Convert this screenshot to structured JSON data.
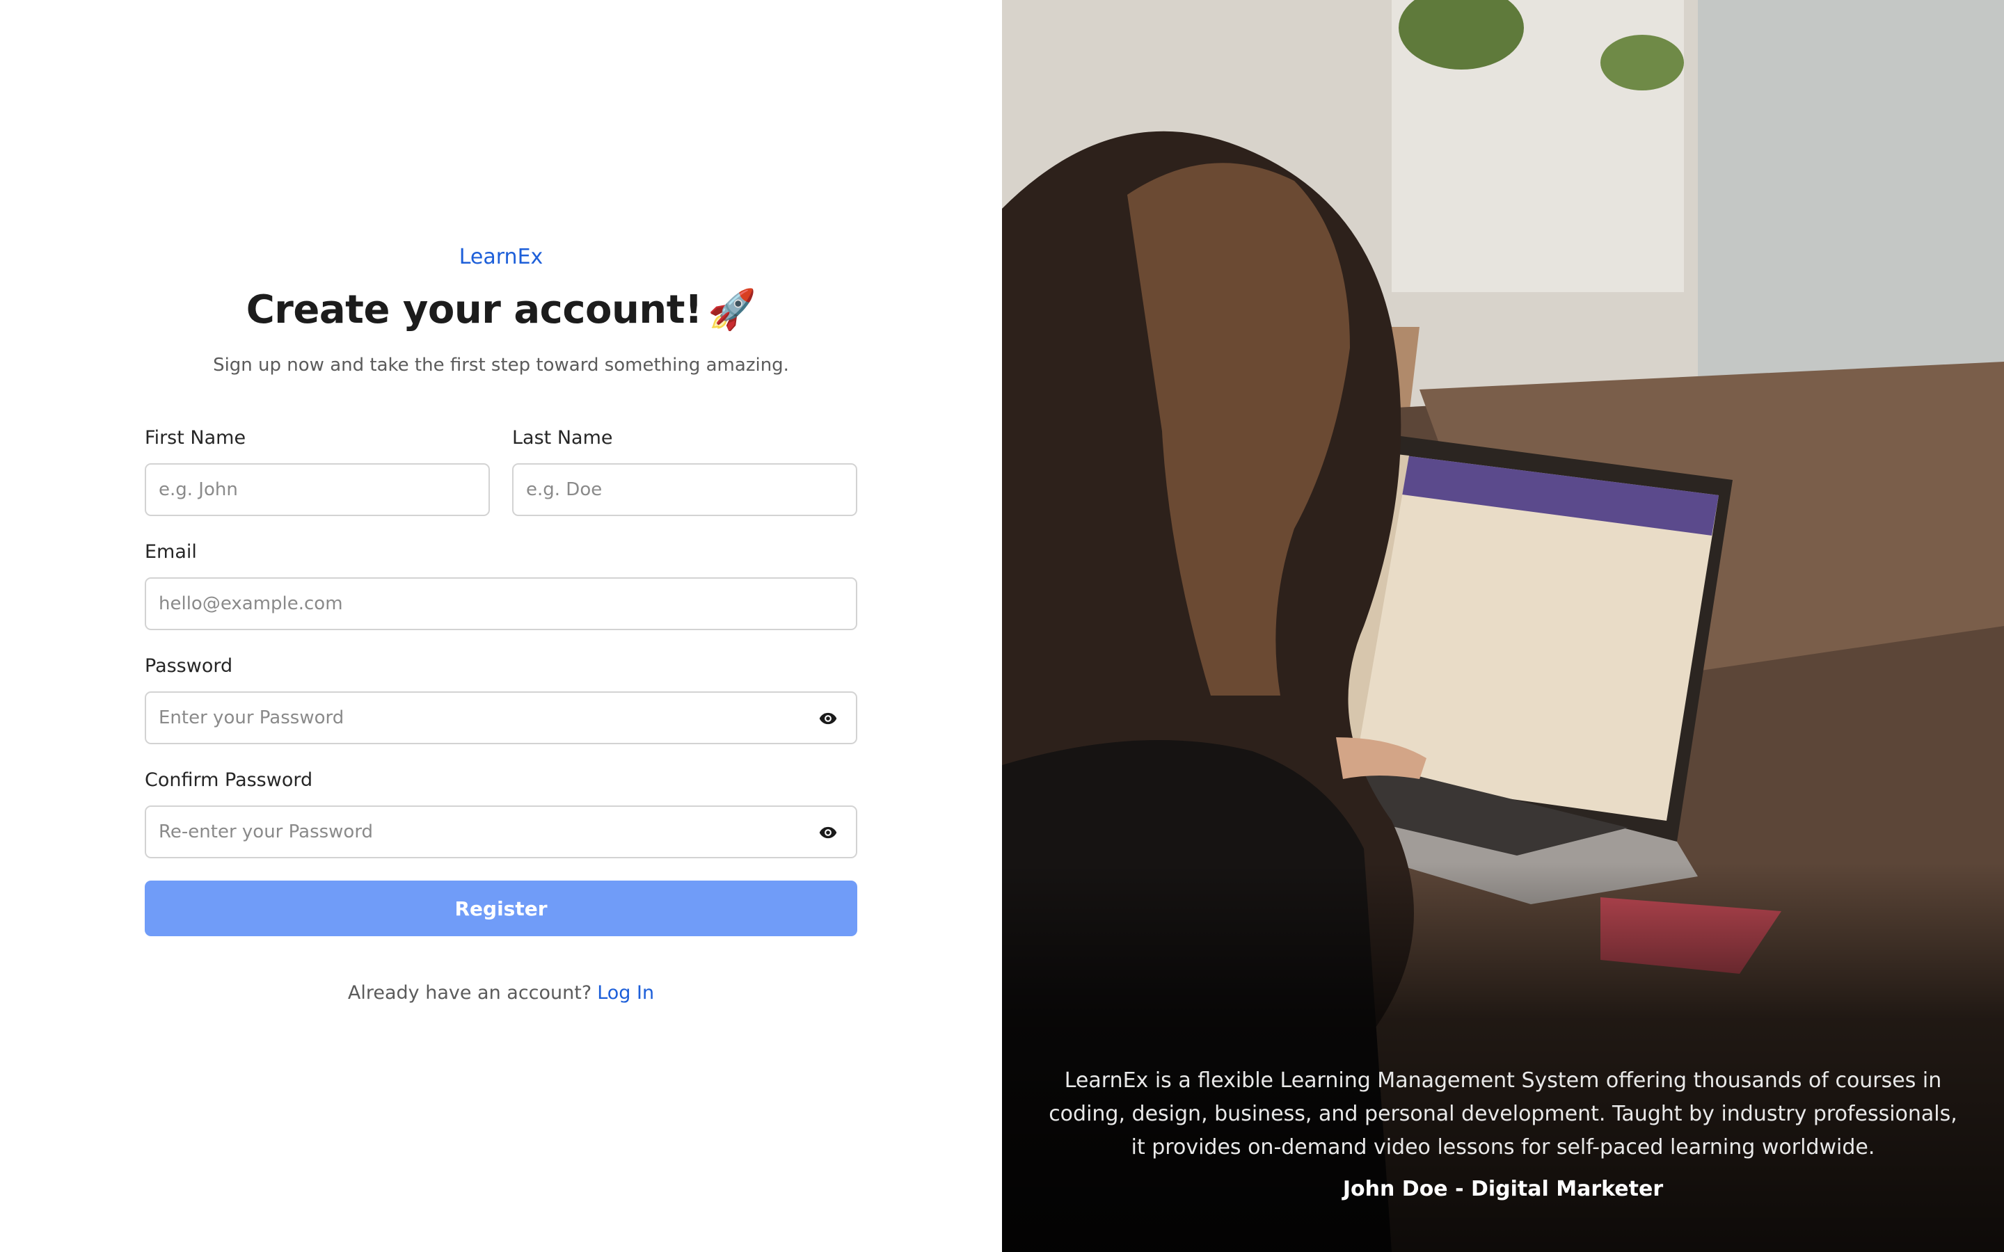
{
  "brand": "LearnEx",
  "title": "Create your account!",
  "title_icon": "rocket-emoji",
  "subtitle": "Sign up now and take the first step toward something amazing.",
  "form": {
    "first_name": {
      "label": "First Name",
      "placeholder": "e.g. John"
    },
    "last_name": {
      "label": "Last Name",
      "placeholder": "e.g. Doe"
    },
    "email": {
      "label": "Email",
      "placeholder": "hello@example.com"
    },
    "password": {
      "label": "Password",
      "placeholder": "Enter your Password",
      "icon": "eye-icon"
    },
    "confirm_password": {
      "label": "Confirm Password",
      "placeholder": "Re-enter your Password",
      "icon": "eye-icon"
    },
    "register_label": "Register"
  },
  "login_prompt": {
    "text": "Already have an account?",
    "link": "Log In"
  },
  "testimonial": {
    "quote": "LearnEx is a flexible Learning Management System offering thousands of courses in coding, design, business, and personal development. Taught by industry professionals, it provides on-demand video lessons for self-paced learning worldwide.",
    "author": "John Doe - Digital Marketer"
  },
  "colors": {
    "brand_blue": "#1d5fd9",
    "button_blue": "#709cf8",
    "input_border": "#d3d3d3"
  }
}
